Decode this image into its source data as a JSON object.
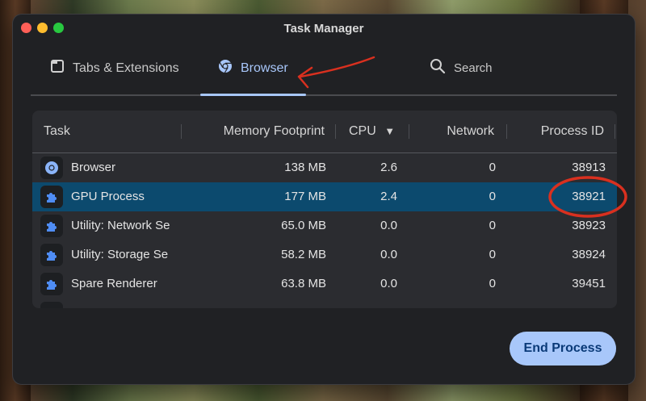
{
  "window": {
    "title": "Task Manager"
  },
  "tabs": [
    {
      "label": "Tabs & Extensions",
      "icon": "tab-window-icon"
    },
    {
      "label": "Browser",
      "icon": "chrome-icon",
      "active": true
    }
  ],
  "search": {
    "label": "Search",
    "icon": "search-icon"
  },
  "table": {
    "columns": [
      "Task",
      "Memory Footprint",
      "CPU",
      "Network",
      "Process ID"
    ],
    "sort_indicator": "▼",
    "rows": [
      {
        "name": "Browser",
        "memory": "138 MB",
        "cpu": "2.6",
        "network": "0",
        "pid": "38913",
        "icon": "chrome-icon"
      },
      {
        "name": "GPU Process",
        "memory": "177 MB",
        "cpu": "2.4",
        "network": "0",
        "pid": "38921",
        "icon": "puzzle-icon",
        "selected": true
      },
      {
        "name": "Utility: Network Se",
        "memory": "65.0 MB",
        "cpu": "0.0",
        "network": "0",
        "pid": "38923",
        "icon": "puzzle-icon"
      },
      {
        "name": "Utility: Storage Se",
        "memory": "58.2 MB",
        "cpu": "0.0",
        "network": "0",
        "pid": "38924",
        "icon": "puzzle-icon"
      },
      {
        "name": "Spare Renderer",
        "memory": "63.8 MB",
        "cpu": "0.0",
        "network": "0",
        "pid": "39451",
        "icon": "puzzle-icon"
      }
    ]
  },
  "actions": {
    "end_process": "End Process"
  },
  "colors": {
    "accent": "#a8c7fa",
    "selected_row": "#0c4a6e",
    "annotation": "#d9301f"
  }
}
